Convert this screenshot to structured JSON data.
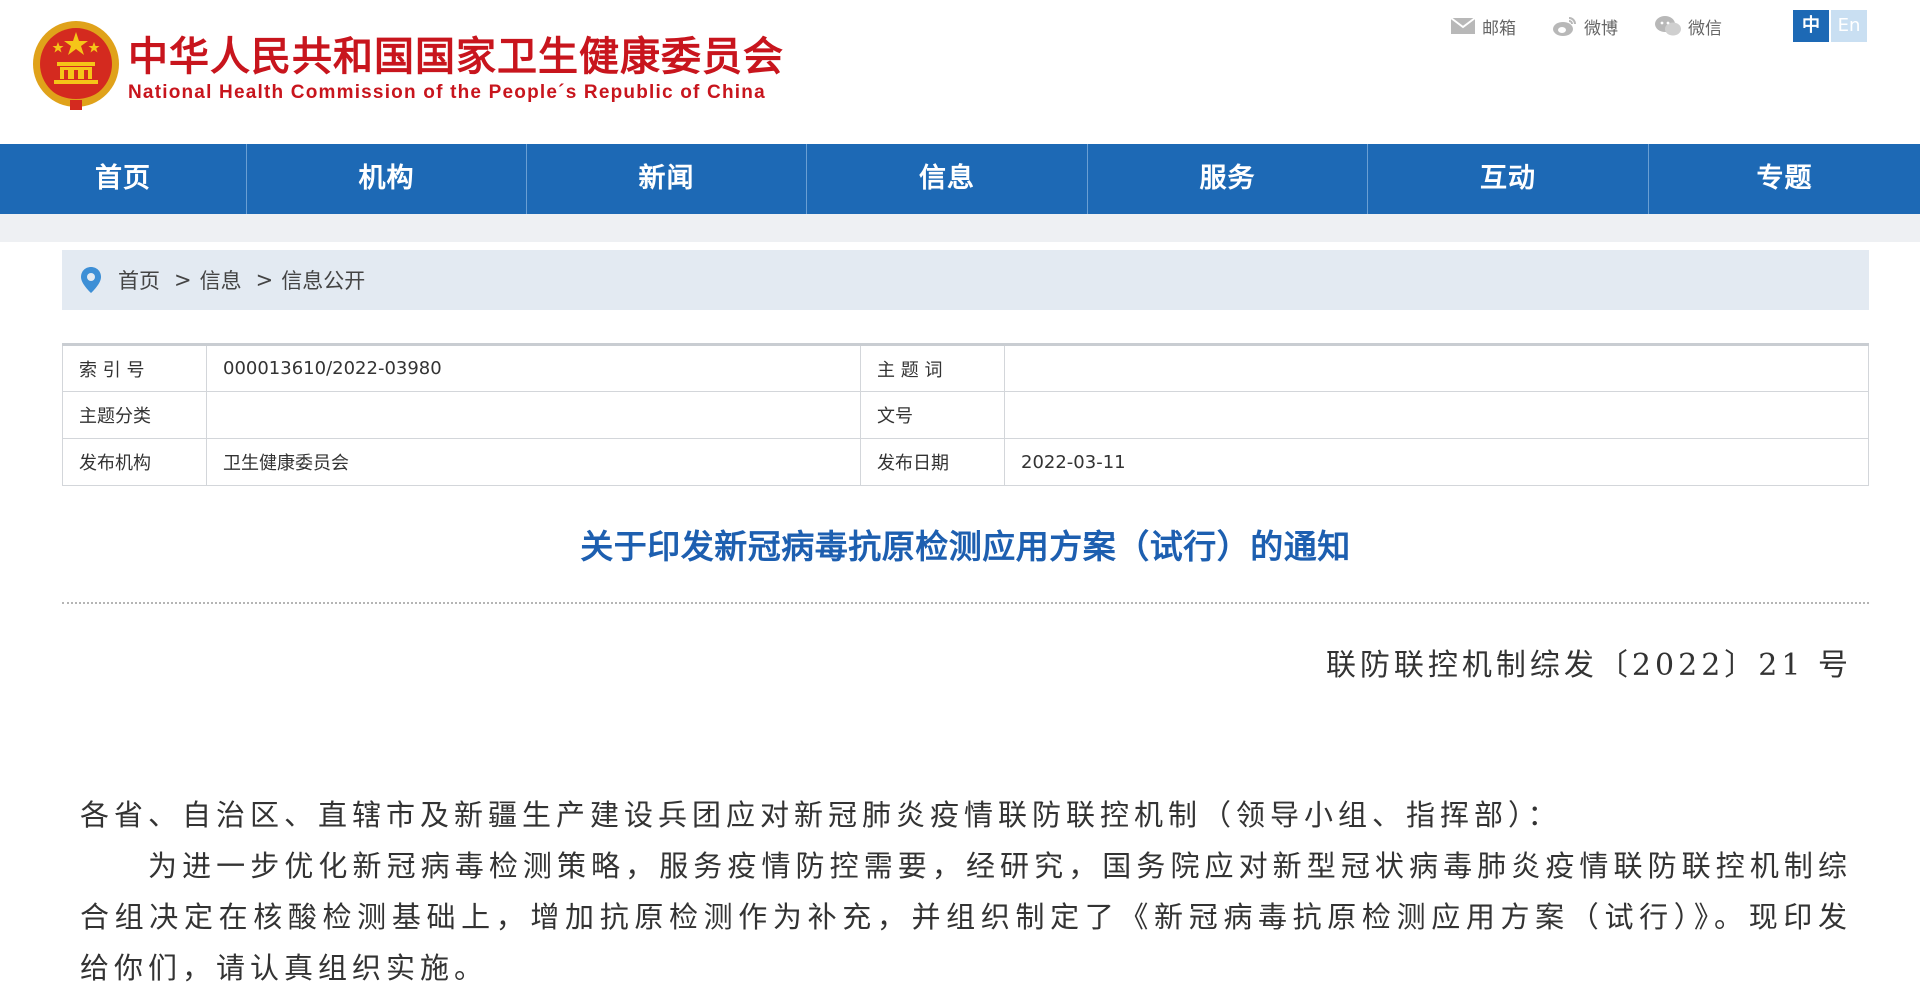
{
  "header": {
    "title_cn": "中华人民共和国国家卫生健康委员会",
    "title_en": "National Health Commission of the People´s Republic of China",
    "links": [
      {
        "icon": "mail-icon",
        "label": "邮箱"
      },
      {
        "icon": "weibo-icon",
        "label": "微博"
      },
      {
        "icon": "wechat-icon",
        "label": "微信"
      }
    ],
    "lang": {
      "cn": "中",
      "en": "En"
    }
  },
  "nav": {
    "items": [
      "首页",
      "机构",
      "新闻",
      "信息",
      "服务",
      "互动",
      "专题"
    ]
  },
  "breadcrumb": {
    "items": [
      "首页",
      "信息",
      "信息公开"
    ],
    "separator": ">"
  },
  "meta": {
    "rows": [
      {
        "label1": "索 引 号",
        "value1": "000013610/2022-03980",
        "label2": "主 题 词",
        "value2": ""
      },
      {
        "label1": "主题分类",
        "value1": "",
        "label2": "文号",
        "value2": ""
      },
      {
        "label1": "发布机构",
        "value1": "卫生健康委员会",
        "label2": "发布日期",
        "value2": "2022-03-11"
      }
    ]
  },
  "document": {
    "title": "关于印发新冠病毒抗原检测应用方案（试行）的通知",
    "number": "联防联控机制综发〔2022〕21 号",
    "salutation": "各省、自治区、直辖市及新疆生产建设兵团应对新冠肺炎疫情联防联控机制（领导小组、指挥部）：",
    "paragraph": "为进一步优化新冠病毒检测策略，服务疫情防控需要，经研究，国务院应对新型冠状病毒肺炎疫情联防联控机制综合组决定在核酸检测基础上，增加抗原检测作为补充，并组织制定了《新冠病毒抗原检测应用方案（试行）》。现印发给你们，请认真组织实施。"
  },
  "colors": {
    "brand_red": "#c8151d",
    "nav_blue": "#1d69b5",
    "title_blue": "#1d5fb0",
    "breadcrumb_bg": "#e3eaf2"
  }
}
